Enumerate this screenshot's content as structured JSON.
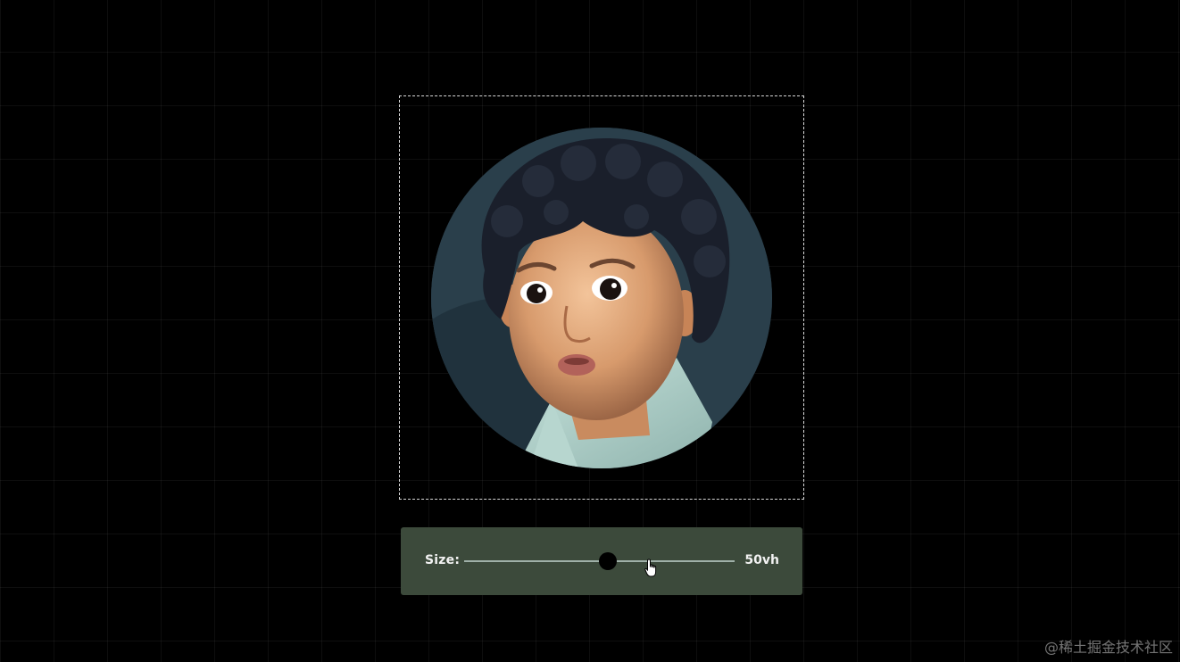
{
  "controls": {
    "size_label": "Size:",
    "size_value": "50vh",
    "slider_fraction": 0.53
  },
  "image": {
    "subject": "portrait photo of a curly-haired toddler"
  },
  "watermark": "@稀土掘金技术社区",
  "colors": {
    "background": "#000000",
    "panel": "#3c4a3b",
    "grid": "#151515"
  },
  "icons": {
    "cursor": "hand-pointer-icon"
  }
}
